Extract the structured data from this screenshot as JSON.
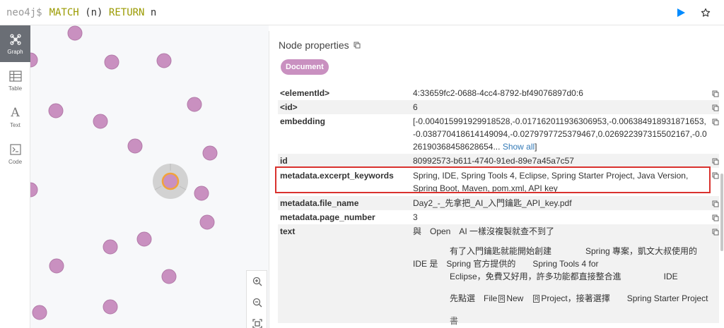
{
  "query": {
    "prompt": "neo4j$",
    "keyword1": "MATCH",
    "pattern": "(n)",
    "keyword2": "RETURN",
    "var": "n"
  },
  "sidebar": [
    {
      "label": "Graph",
      "icon": "graph-icon",
      "active": true
    },
    {
      "label": "Table",
      "icon": "table-icon",
      "active": false
    },
    {
      "label": "Text",
      "icon": "text-icon",
      "glyph": "A",
      "active": false
    },
    {
      "label": "Code",
      "icon": "code-icon",
      "active": false
    }
  ],
  "panel": {
    "title": "Node properties",
    "label_badge": "Document",
    "rows": [
      {
        "key": "<elementId>",
        "value": "4:33659fc2-0688-4cc4-8792-bf49076897d0:6"
      },
      {
        "key": "<id>",
        "value": "6"
      },
      {
        "key": "embedding",
        "value": "[-0.004015991929918528,-0.017162011936306953,-0.006384918931871653,-0.038770418614149094,-0.0279797725379467,0.026922397315502167,-0.026190368458628654...",
        "link": "Show all",
        "suffix": "]"
      },
      {
        "key": "id",
        "value": "80992573-b611-4740-91ed-89e7a45a7c57"
      },
      {
        "key": "metadata.excerpt_keywords",
        "value": "Spring, IDE, Spring Tools 4, Eclipse, Spring Starter Project, Java Version, Spring Boot, Maven, pom.xml, API key"
      },
      {
        "key": "metadata.file_name",
        "value": "Day2_-_先拿把_AI_入門鑰匙_API_key.pdf"
      },
      {
        "key": "metadata.page_number",
        "value": "3"
      },
      {
        "key": "text",
        "lines": [
          "與　Open　AI 一樣沒複製就查不到了",
          "有了入門鑰匙就能開始創建　　　　Spring 專案，凱文大叔使用的",
          "IDE 是　Spring 官方提供的　　Spring Tools 4 for",
          "Eclipse，免費又好用，許多功能都直接整合進　　　　　IDE",
          "先點選　File",
          "New",
          "Project，接著選擇　　Spring Starter Project",
          "書"
        ]
      }
    ]
  },
  "colors": {
    "node": "#c990c0",
    "node_stroke": "#b27aa8",
    "highlight": "#d9322e",
    "run": "#018bff"
  }
}
